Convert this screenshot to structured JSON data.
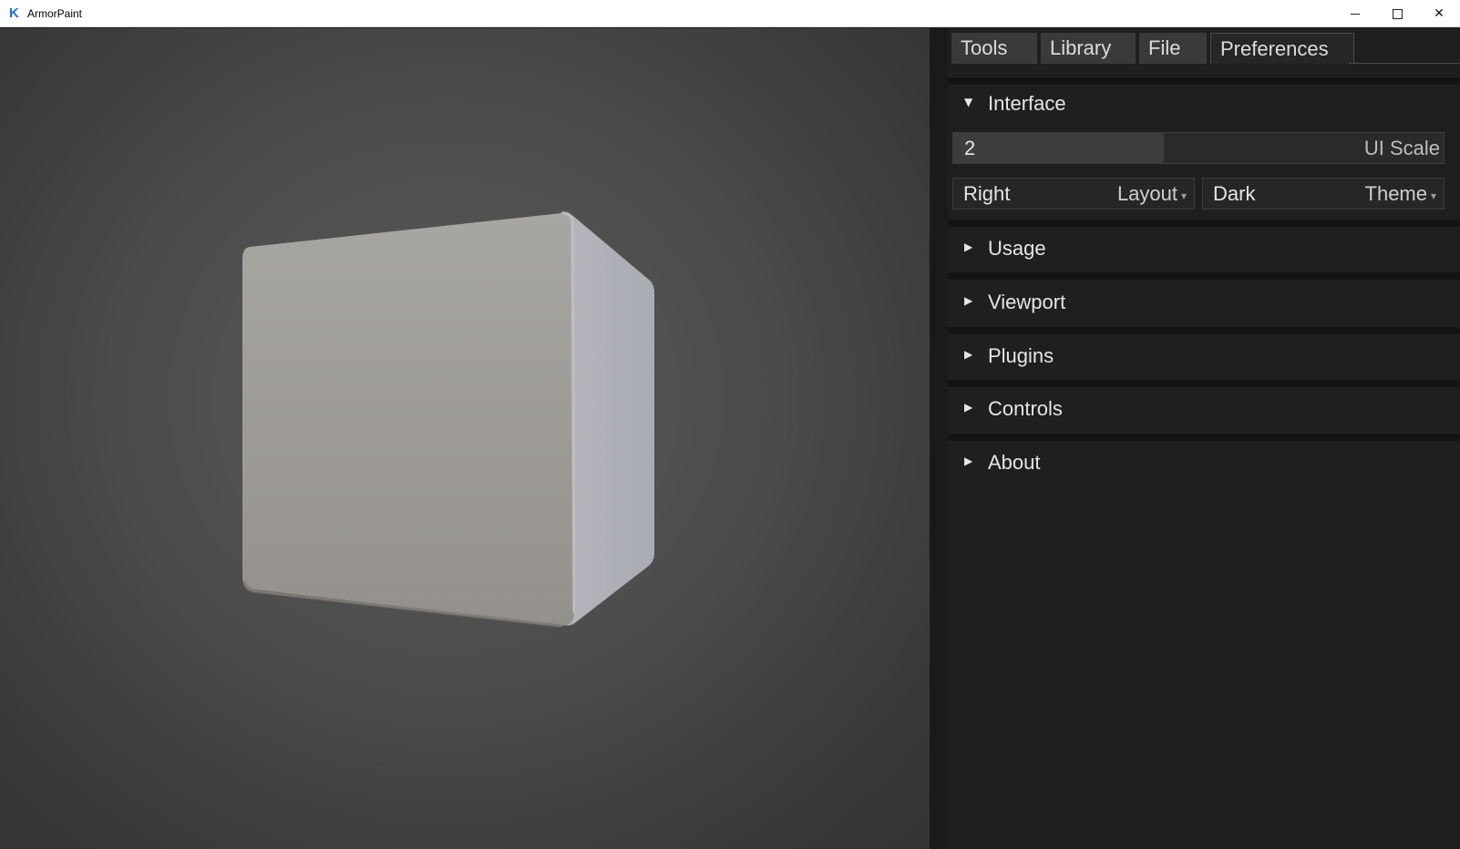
{
  "window": {
    "title": "ArmorPaint",
    "logo_letter": "K",
    "minimize_icon": "minimize-icon",
    "maximize_icon": "maximize-icon",
    "close_label": "✕"
  },
  "tabs": [
    {
      "label": "Tools"
    },
    {
      "label": "Library"
    },
    {
      "label": "File"
    },
    {
      "label": "Preferences",
      "active": true
    }
  ],
  "interface": {
    "header": "Interface",
    "expanded": true,
    "ui_scale": {
      "value": "2",
      "label": "UI Scale",
      "fill_fraction": 0.43
    },
    "layout": {
      "value": "Right",
      "label": "Layout"
    },
    "theme": {
      "value": "Dark",
      "label": "Theme"
    }
  },
  "sections": [
    {
      "label": "Usage"
    },
    {
      "label": "Viewport"
    },
    {
      "label": "Plugins"
    },
    {
      "label": "Controls"
    },
    {
      "label": "About"
    }
  ],
  "arrows": {
    "expanded": "▼",
    "collapsed": "▶",
    "caret": "▼"
  },
  "colors": {
    "viewport_bg": "#4c4c4c",
    "panel_bg": "#1f1f1f",
    "cube": "#a19e9a"
  }
}
